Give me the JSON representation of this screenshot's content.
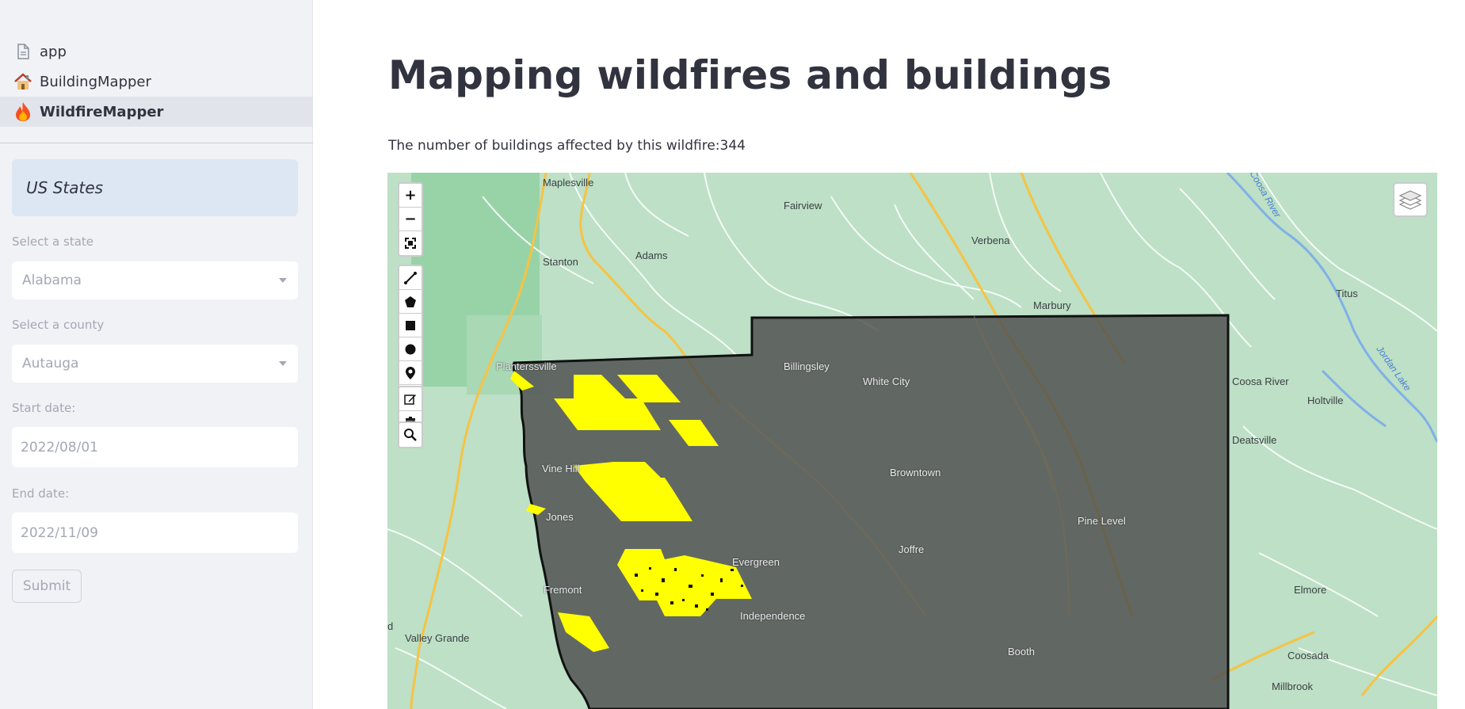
{
  "nav": {
    "items": [
      {
        "label": "app",
        "icon": "page-icon"
      },
      {
        "label": "BuildingMapper",
        "icon": "house-emoji"
      },
      {
        "label": "WildfireMapper",
        "icon": "fire-emoji"
      }
    ]
  },
  "sidebar": {
    "section_title": "US States",
    "state_label": "Select a state",
    "state_value": "Alabama",
    "county_label": "Select a county",
    "county_value": "Autauga",
    "start_label": "Start date:",
    "start_value": "2022/08/01",
    "end_label": "End date:",
    "end_value": "2022/11/09",
    "submit_label": "Submit"
  },
  "main": {
    "title": "Mapping wildfires and buildings",
    "info": "The number of buildings affected by this wildfire:344"
  },
  "map": {
    "zoom_in": "+",
    "zoom_out": "−",
    "labels": [
      "Maplesville",
      "Fairview",
      "Verbena",
      "Stanton",
      "Adams",
      "Titus",
      "Marbury",
      "Planterssville",
      "Billingsley",
      "White City",
      "Coosa River",
      "Holtville",
      "Jordan Lake",
      "Deatsville",
      "Vine Hill",
      "Browntown",
      "Jones",
      "Pine Level",
      "Evergreen",
      "Joffre",
      "Fremont",
      "Independence",
      "Elmore",
      "Valley Grande",
      "Booth",
      "Coosada",
      "Millbrook",
      "Coosa River",
      "d"
    ],
    "colors": {
      "county_fill": "#4d4d4d",
      "fire_fill": "#ffff00",
      "base": "#bde0c6"
    }
  }
}
